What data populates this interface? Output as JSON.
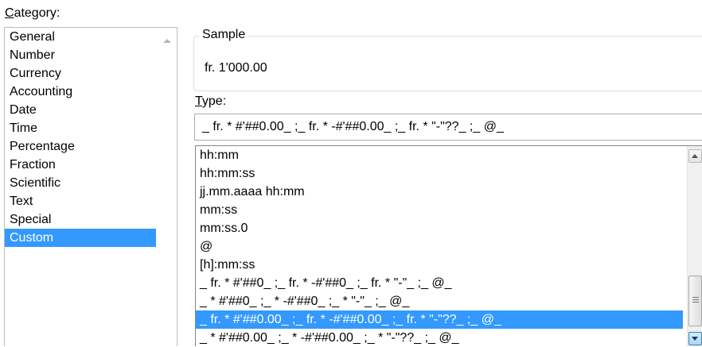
{
  "category": {
    "label_accesskey": "C",
    "label_rest": "ategory:",
    "items": [
      "General",
      "Number",
      "Currency",
      "Accounting",
      "Date",
      "Time",
      "Percentage",
      "Fraction",
      "Scientific",
      "Text",
      "Special",
      "Custom"
    ],
    "selected_index": 11
  },
  "sample": {
    "caption": "Sample",
    "value": "fr. 1'000.00"
  },
  "type": {
    "label_accesskey": "T",
    "label_rest": "ype:",
    "value": "_ fr. * #'##0.00_ ;_ fr. * -#'##0.00_ ;_ fr. * \"-\"??_ ;_ @_"
  },
  "formats": {
    "items": [
      "hh:mm",
      "hh:mm:ss",
      "jj.mm.aaaa hh:mm",
      "mm:ss",
      "mm:ss.0",
      "@",
      "[h]:mm:ss",
      "_ fr. * #'##0_ ;_ fr. * -#'##0_ ;_ fr. * \"-\"_ ;_ @_",
      "_ * #'##0_ ;_ * -#'##0_ ;_ * \"-\"_ ;_ @_",
      "_ fr. * #'##0.00_ ;_ fr. * -#'##0.00_ ;_ fr. * \"-\"??_ ;_ @_",
      "_ * #'##0.00_ ;_ * -#'##0.00_ ;_ * \"-\"??_ ;_ @_"
    ],
    "selected_index": 9
  }
}
